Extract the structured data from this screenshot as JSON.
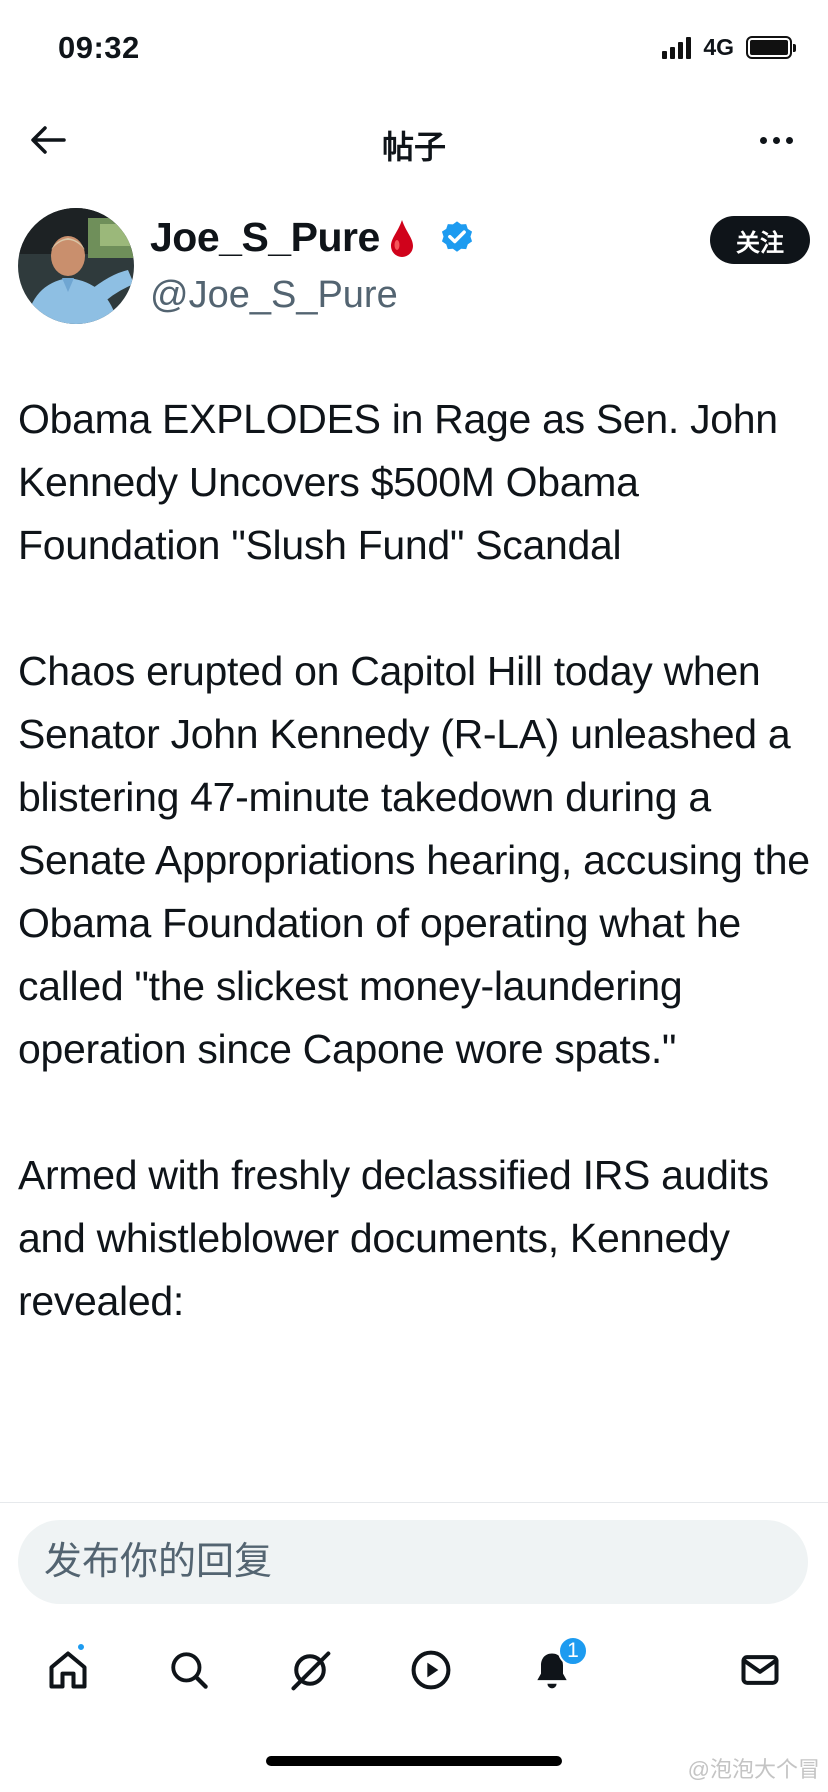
{
  "status_bar": {
    "time": "09:32",
    "network": "4G"
  },
  "nav": {
    "title": "帖子"
  },
  "author": {
    "display_name": "Joe_S_Pure",
    "handle": "@Joe_S_Pure",
    "follow_label": "关注"
  },
  "post": {
    "paragraphs": [
      "Obama EXPLODES in Rage as Sen. John Kennedy Uncovers $500M Obama Foundation \"Slush Fund\" Scandal",
      "Chaos erupted on Capitol Hill today when Senator John Kennedy (R-LA) unleashed a blistering 47-minute takedown during a Senate Appropriations hearing, accusing the Obama Foundation of operating what he called \"the slickest money-laundering operation since Capone wore spats.\"",
      "Armed with freshly declassified IRS audits and whistleblower documents, Kennedy revealed:"
    ]
  },
  "reply": {
    "placeholder": "发布你的回复"
  },
  "tabs": {
    "notifications_badge": "1"
  },
  "watermark": "@泡泡大个冒",
  "colors": {
    "accent": "#1d9bf0",
    "text": "#0f1419",
    "muted": "#536471"
  }
}
